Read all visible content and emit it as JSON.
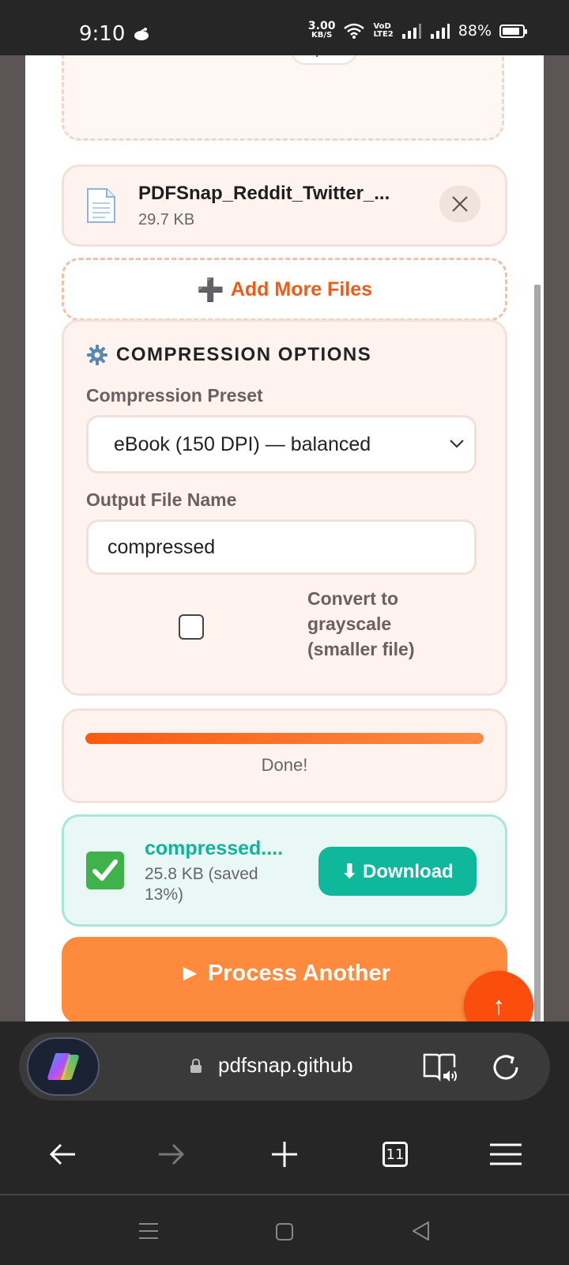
{
  "status_bar": {
    "time": "9:10",
    "net_speed_value": "3.00",
    "net_speed_unit": "KB/S",
    "volte_label_top": "VoD",
    "volte_label_bottom": "LTE2",
    "battery_percent": "88%",
    "battery_level": 0.88
  },
  "dropzone": {
    "accepted_type": ".pdf"
  },
  "file": {
    "name": "PDFSnap_Reddit_Twitter_...",
    "size": "29.7 KB",
    "icon": "document-icon"
  },
  "add_more": {
    "icon": "➕",
    "label": "Add More Files"
  },
  "options": {
    "heading_icon": "gear-icon",
    "heading": "COMPRESSION OPTIONS",
    "preset_label": "Compression Preset",
    "preset_value": "eBook (150 DPI) — balanced",
    "filename_label": "Output File Name",
    "filename_value": "compressed",
    "grayscale_label": "Convert to grayscale (smaller file)",
    "grayscale_checked": false
  },
  "progress": {
    "value": 1.0,
    "status": "Done!"
  },
  "result": {
    "icon": "check-mark-icon",
    "file_name": "compressed....",
    "info": "25.8 KB (saved 13%)",
    "download_label": "⬇ Download"
  },
  "process_another": {
    "label": "► Process Another"
  },
  "fab": {
    "label": "↑"
  },
  "browser": {
    "url": "pdfsnap.github",
    "tab_count": "11"
  },
  "colors": {
    "accent_orange": "#ef5b18",
    "success_teal": "#0fb89a",
    "process_orange": "#fd8a3d",
    "fab_red_orange": "#fa4d0e"
  }
}
